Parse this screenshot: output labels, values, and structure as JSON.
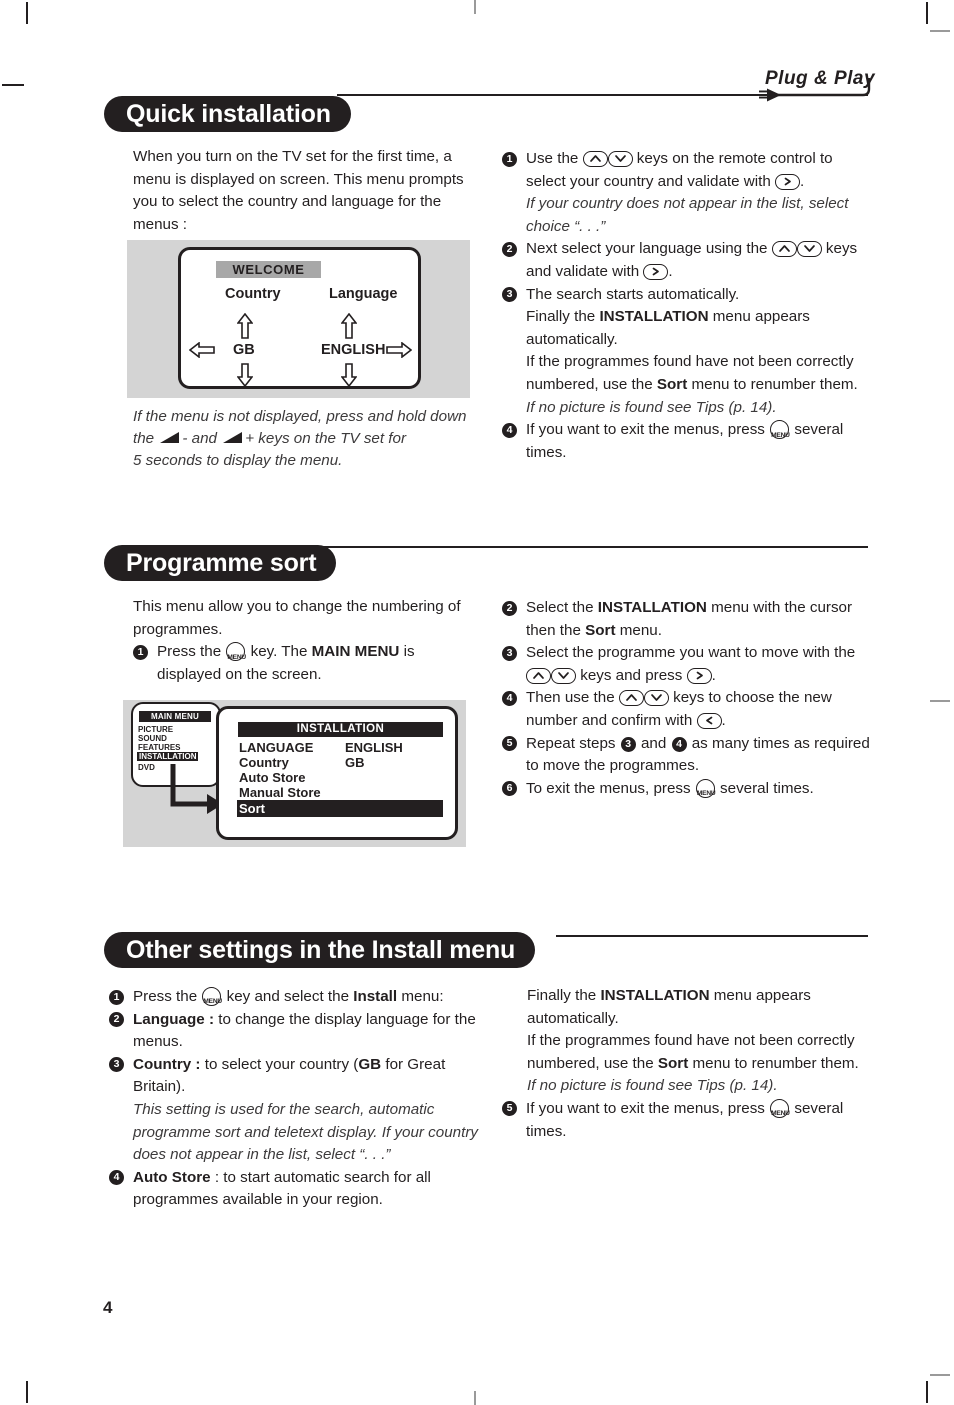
{
  "page": {
    "number": "4",
    "logo": {
      "text": "Plug & Play",
      "icon": "power-plug-icon"
    }
  },
  "sections": [
    {
      "id": "quick-installation",
      "title": "Quick installation",
      "intro": "When you turn on the TV set for the first time, a menu is displayed on screen. This menu prompts you to select the country and language for the menus :",
      "figure": {
        "name": "welcome-menu-screen",
        "title": "WELCOME",
        "col1_header": "Country",
        "col1_value": "GB",
        "col2_header": "Language",
        "col2_value": "ENGLISH"
      },
      "caption": {
        "line1": "If the menu is not displayed, press and hold down",
        "line2_a": "the",
        "line2_b": "- and",
        "line2_c": "+ keys on the TV set for",
        "line3": "5 seconds to display the menu."
      },
      "steps": [
        {
          "num": "1",
          "parts": [
            {
              "t": "text",
              "v": "Use the "
            },
            {
              "t": "key",
              "v": "up-key"
            },
            {
              "t": "key",
              "v": "down-key"
            },
            {
              "t": "text",
              "v": " keys on the remote control to select your country and validate with "
            },
            {
              "t": "key",
              "v": "right-key"
            },
            {
              "t": "text",
              "v": "."
            }
          ],
          "note": "If your country does not appear in the list, select choice “. . .”"
        },
        {
          "num": "2",
          "parts": [
            {
              "t": "text",
              "v": "Next select your language using the "
            },
            {
              "t": "key",
              "v": "up-key"
            },
            {
              "t": "key",
              "v": "down-key"
            },
            {
              "t": "text",
              "v": " keys and validate with "
            },
            {
              "t": "key",
              "v": "right-key"
            },
            {
              "t": "text",
              "v": "."
            }
          ]
        },
        {
          "num": "3",
          "lines": [
            "The search starts automatically.",
            "Finally the INSTALLATION menu appears automatically.",
            "If the programmes found have not been correctly numbered, use the Sort menu to renumber them."
          ],
          "note": "If no picture is found see Tips (p. 14)."
        },
        {
          "num": "4",
          "parts": [
            {
              "t": "text",
              "v": "If you want to exit the menus, press "
            },
            {
              "t": "key",
              "v": "menu-key"
            },
            {
              "t": "text",
              "v": " several times."
            }
          ]
        }
      ]
    },
    {
      "id": "programme-sort",
      "title": "Programme sort",
      "intro": "This menu allow you to change the numbering of programmes.",
      "step1": {
        "num": "1",
        "parts": [
          {
            "t": "text",
            "v": "Press the "
          },
          {
            "t": "key",
            "v": "menu-key"
          },
          {
            "t": "text",
            "v": " key. The MAIN MENU is displayed on the screen."
          }
        ]
      },
      "figure": {
        "name": "main-menu-installation-screens",
        "main_menu_title": "MAIN MENU",
        "main_menu_items": [
          "PICTURE",
          "SOUND",
          "FEATURES",
          "INSTALLATION",
          "DVD"
        ],
        "main_menu_selected": "INSTALLATION",
        "installation_title": "INSTALLATION",
        "installation_rows": [
          {
            "label": "LANGUAGE",
            "value": "ENGLISH"
          },
          {
            "label": "Country",
            "value": "GB"
          },
          {
            "label": "Auto Store",
            "value": ""
          },
          {
            "label": "Manual Store",
            "value": ""
          },
          {
            "label": "Sort",
            "value": ""
          }
        ],
        "installation_selected": "Sort"
      },
      "steps": [
        {
          "num": "2",
          "text": "Select the INSTALLATION menu with the cursor then the Sort menu."
        },
        {
          "num": "3",
          "parts": [
            {
              "t": "text",
              "v": "Select the programme you want to move with the "
            },
            {
              "t": "key",
              "v": "up-key"
            },
            {
              "t": "key",
              "v": "down-key"
            },
            {
              "t": "text",
              "v": " keys and press "
            },
            {
              "t": "key",
              "v": "right-key"
            },
            {
              "t": "text",
              "v": "."
            }
          ]
        },
        {
          "num": "4",
          "parts": [
            {
              "t": "text",
              "v": "Then use the "
            },
            {
              "t": "key",
              "v": "up-key"
            },
            {
              "t": "key",
              "v": "down-key"
            },
            {
              "t": "text",
              "v": " keys to choose the new number and confirm with "
            },
            {
              "t": "key",
              "v": "left-key"
            },
            {
              "t": "text",
              "v": "."
            }
          ]
        },
        {
          "num": "5",
          "parts": [
            {
              "t": "text",
              "v": "Repeat steps "
            },
            {
              "t": "bullet",
              "v": "3"
            },
            {
              "t": "text",
              "v": " and "
            },
            {
              "t": "bullet",
              "v": "4"
            },
            {
              "t": "text",
              "v": "  as many times as required to move the programmes."
            }
          ]
        },
        {
          "num": "6",
          "parts": [
            {
              "t": "text",
              "v": "To exit the menus, press "
            },
            {
              "t": "key",
              "v": "menu-key"
            },
            {
              "t": "text",
              "v": " several times."
            }
          ]
        }
      ]
    },
    {
      "id": "other-settings",
      "title": "Other settings in the Install menu",
      "left_steps": [
        {
          "num": "1",
          "parts": [
            {
              "t": "text",
              "v": "Press the "
            },
            {
              "t": "key",
              "v": "menu-key"
            },
            {
              "t": "text",
              "v": " key and select the Install menu:"
            }
          ]
        },
        {
          "num": "2",
          "bold": "Language :",
          "text": " to change the display language for the menus."
        },
        {
          "num": "3",
          "bold": "Country :",
          "text": " to select your country (GB for Great Britain).",
          "note": "This setting is used for the search, automatic programme sort and teletext display. If your country does not appear in the list, select “. . .”"
        },
        {
          "num": "4",
          "bold": "Auto Store",
          "text": " : to start automatic search for all programmes available in your region."
        }
      ],
      "right_block": {
        "lines": [
          "Finally the INSTALLATION menu appears automatically.",
          "If the programmes found have not been correctly numbered, use the Sort menu to renumber them."
        ],
        "note": "If no picture is found see Tips (p. 14).",
        "last_step": {
          "num": "5",
          "parts": [
            {
              "t": "text",
              "v": "If you want to exit the menus, press "
            },
            {
              "t": "key",
              "v": "menu-key"
            },
            {
              "t": "text",
              "v": " several times."
            }
          ]
        }
      }
    }
  ]
}
